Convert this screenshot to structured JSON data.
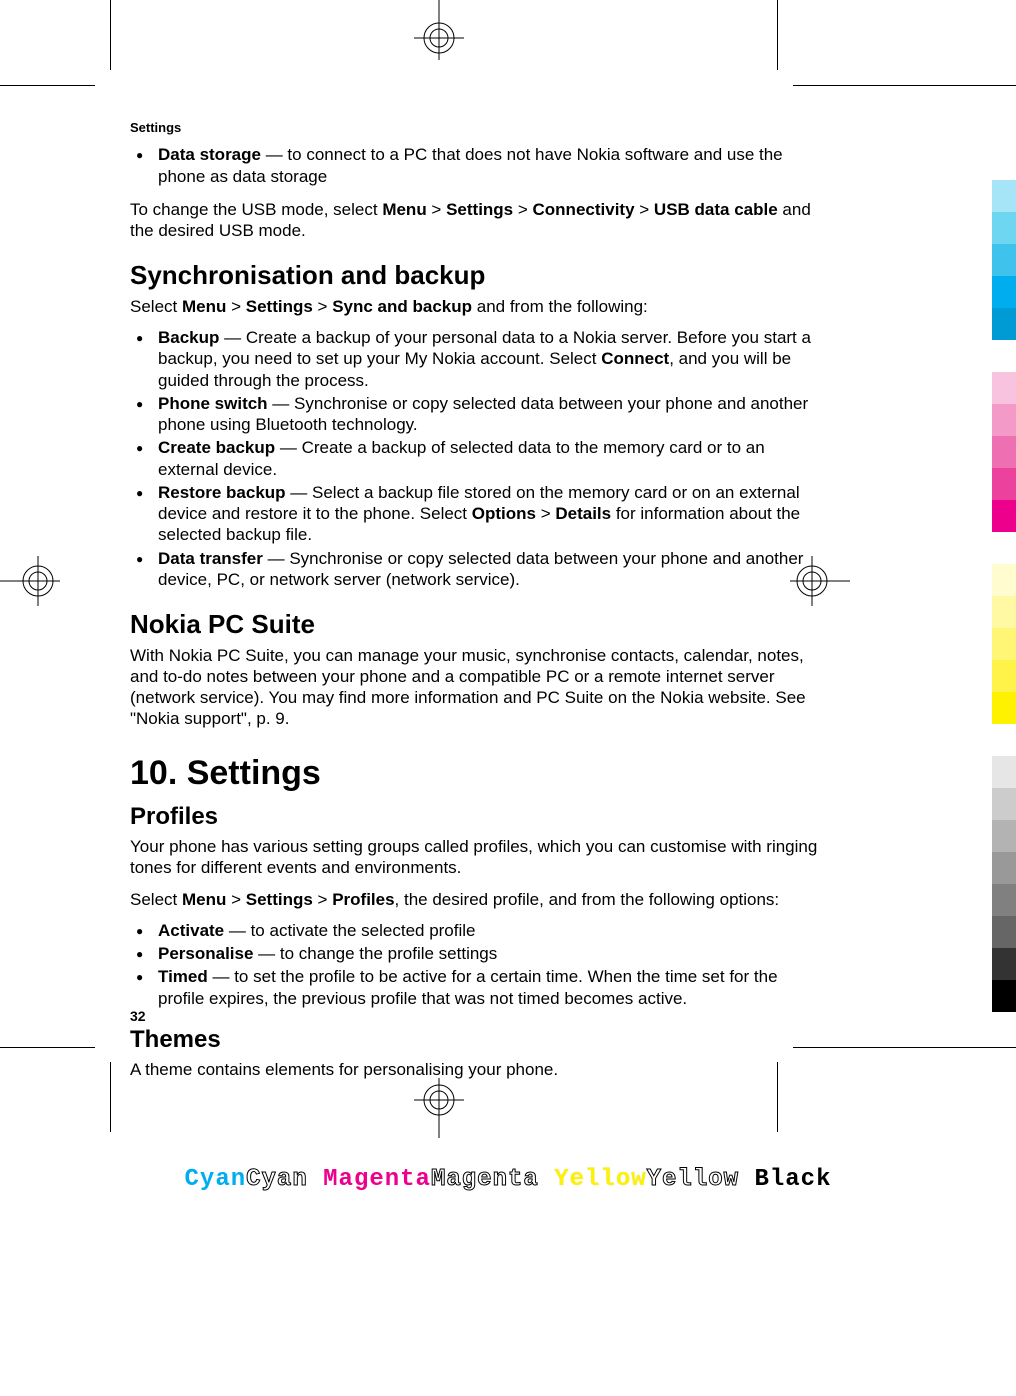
{
  "headerLabel": "Settings",
  "pageNumber": "32",
  "dataStorage": {
    "term": "Data storage",
    "desc": " — to connect to a PC that does not have Nokia software and use the phone as data storage"
  },
  "usbMode": {
    "prefix": "To change the USB mode, select ",
    "path1": "Menu",
    "gt1": " > ",
    "path2": "Settings",
    "gt2": " > ",
    "path3": "Connectivity",
    "gt3": " > ",
    "path4": "USB data cable",
    "suffix": " and the desired USB mode."
  },
  "sync": {
    "heading": "Synchronisation and backup",
    "introPrefix": "Select ",
    "p1": "Menu",
    "g1": " > ",
    "p2": "Settings",
    "g2": " > ",
    "p3": "Sync and backup",
    "introSuffix": " and from the following:",
    "items": [
      {
        "term": "Backup",
        "desc1": " — Create a backup of your personal data to a Nokia server. Before you start a backup, you need to set up your My Nokia account. Select ",
        "bold": "Connect",
        "desc2": ", and you will be guided through the process."
      },
      {
        "term": "Phone switch",
        "desc1": " — Synchronise or copy selected data between your phone and another phone using Bluetooth technology.",
        "bold": "",
        "desc2": ""
      },
      {
        "term": "Create backup",
        "desc1": " — Create a backup of selected data to the memory card or to an external device.",
        "bold": "",
        "desc2": ""
      },
      {
        "term": "Restore backup",
        "desc1": " — Select a backup file stored on the memory card or on an external device and restore it to the phone. Select ",
        "bold": "Options",
        "mid": " > ",
        "bold2": "Details",
        "desc2": " for information about the selected backup file."
      },
      {
        "term": "Data transfer",
        "desc1": " — Synchronise or copy selected data between your phone and another device, PC, or network server (network service).",
        "bold": "",
        "desc2": ""
      }
    ]
  },
  "pcsuite": {
    "heading": "Nokia PC Suite",
    "body": "With Nokia PC Suite, you can manage your music, synchronise contacts, calendar, notes, and to-do notes between your phone and a compatible PC or a remote internet server (network service). You may find more information and PC Suite on the Nokia website. See \"Nokia support\", p. 9."
  },
  "chapter": {
    "heading": "10.  Settings"
  },
  "profiles": {
    "heading": "Profiles",
    "intro": "Your phone has various setting groups called profiles, which you can customise with ringing tones for different events and environments.",
    "selPrefix": "Select ",
    "p1": "Menu",
    "g1": " > ",
    "p2": "Settings",
    "g2": " > ",
    "p3": "Profiles",
    "selSuffix": ", the desired profile, and from the following options:",
    "items": [
      {
        "term": "Activate",
        "desc": " — to activate the selected profile"
      },
      {
        "term": "Personalise",
        "desc": " — to change the profile settings"
      },
      {
        "term": "Timed",
        "desc": " — to set the profile to be active for a certain time. When the time set for the profile expires, the previous profile that was not timed becomes active."
      }
    ]
  },
  "themes": {
    "heading": "Themes",
    "body": "A theme contains elements for personalising your phone."
  },
  "cmyk": {
    "c": "Cyan",
    "m": "Magenta",
    "y": "Yellow",
    "k": "Black"
  },
  "colorBars": [
    "#A5E5F7",
    "#6FD6F2",
    "#3FC3EC",
    "#00AEEF",
    "#009AD5",
    "gap",
    "#F7C3DF",
    "#F39AC9",
    "#EF6FB3",
    "#EC429D",
    "#EC008C",
    "gap",
    "#FFFCCF",
    "#FFF9A3",
    "#FFF676",
    "#FFF34A",
    "#FFF200",
    "gap",
    "#E6E6E6",
    "#CCCCCC",
    "#B3B3B3",
    "#999999",
    "#808080",
    "#666666",
    "#333333",
    "#000000"
  ]
}
